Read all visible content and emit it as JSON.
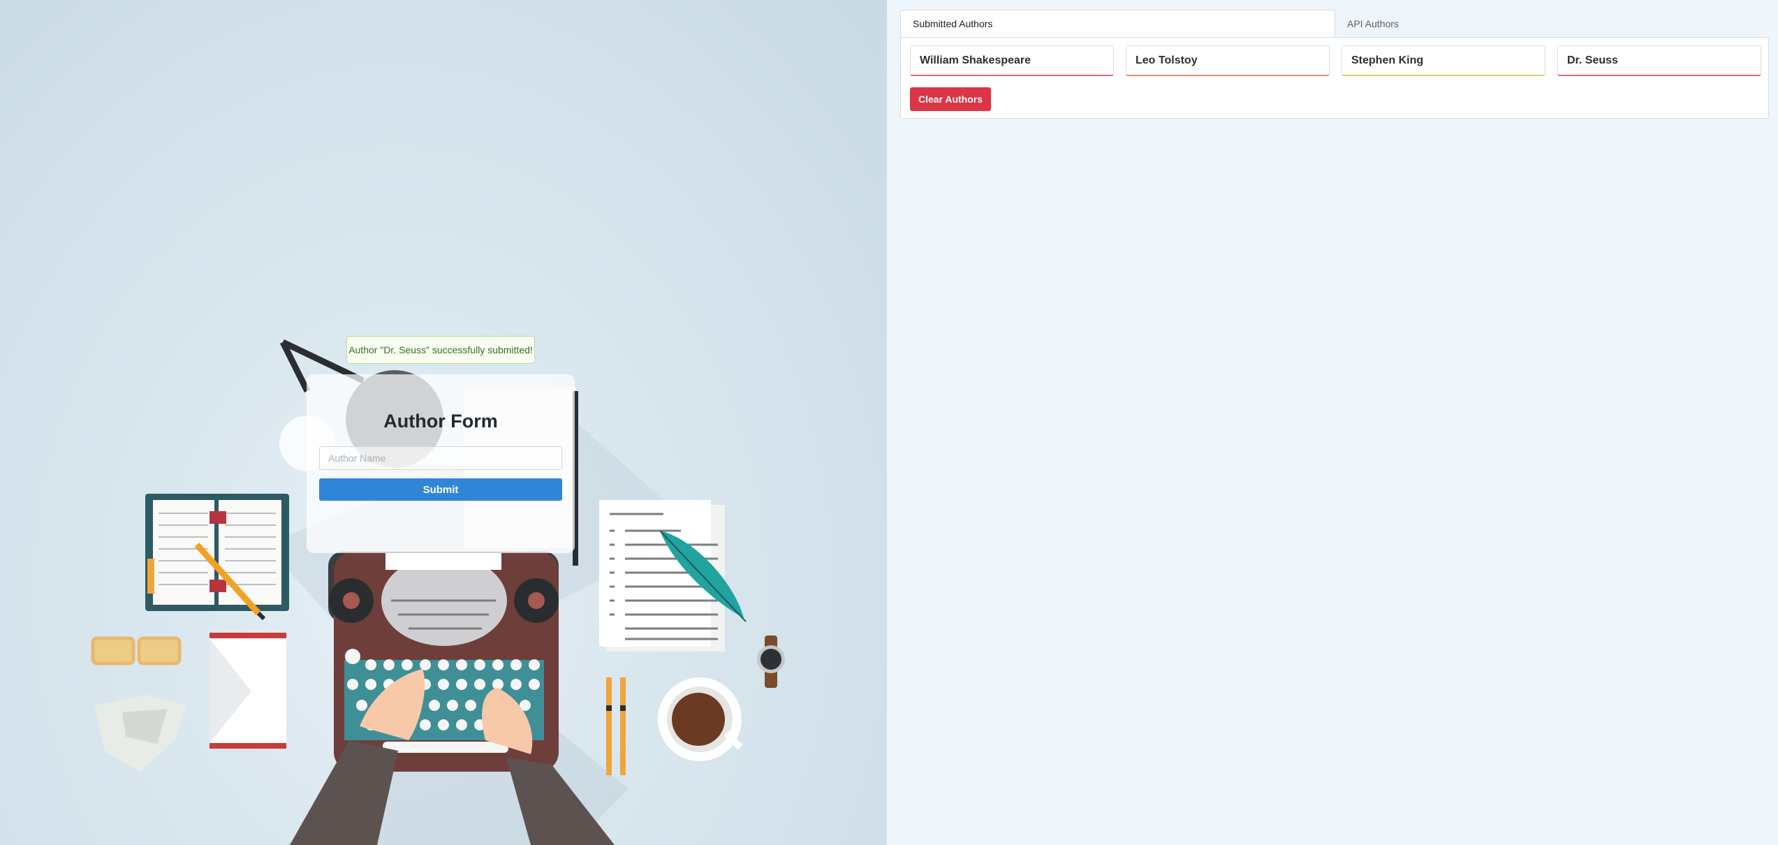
{
  "form": {
    "alert_text": "Author \"Dr. Seuss\" successfully submitted!",
    "title": "Author Form",
    "author_input_placeholder": "Author Name",
    "author_input_value": "",
    "submit_label": "Submit"
  },
  "tabs": [
    {
      "label": "Submitted Authors",
      "active": true
    },
    {
      "label": "API Authors",
      "active": false
    }
  ],
  "authors": [
    {
      "name": "William Shakespeare",
      "accent": "#e4677a"
    },
    {
      "name": "Leo Tolstoy",
      "accent": "#e88a72"
    },
    {
      "name": "Stephen King",
      "accent": "#e4cd64"
    },
    {
      "name": "Dr. Seuss",
      "accent": "#e4677a"
    }
  ],
  "actions": {
    "clear_label": "Clear Authors"
  },
  "colors": {
    "submit_button": "#2f86d6",
    "clear_button": "#dc3545",
    "alert_border": "#b9d9a0"
  }
}
